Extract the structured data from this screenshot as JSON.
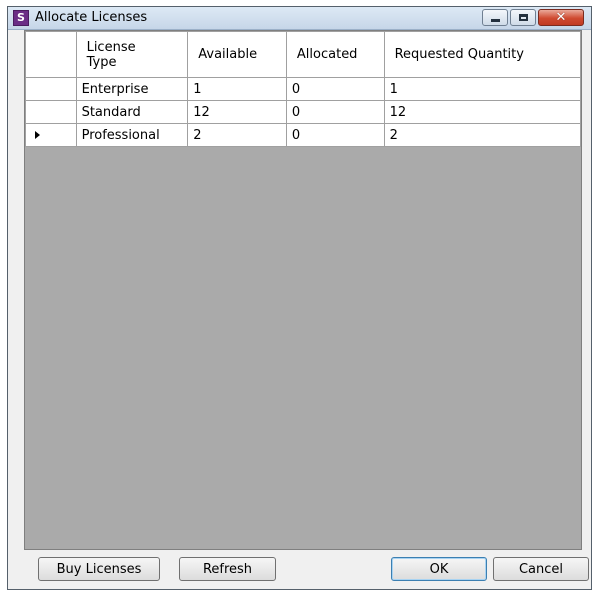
{
  "window": {
    "title": "Allocate Licenses",
    "app_icon_letter": "S"
  },
  "grid": {
    "columns": [
      {
        "label": "License\nType"
      },
      {
        "label": "Available"
      },
      {
        "label": "Allocated"
      },
      {
        "label": "Requested Quantity"
      }
    ],
    "rows": [
      {
        "license_type": "Enterprise",
        "available": "1",
        "allocated": "0",
        "requested": "1",
        "current": false
      },
      {
        "license_type": "Standard",
        "available": "12",
        "allocated": "0",
        "requested": "12",
        "current": false
      },
      {
        "license_type": "Professional",
        "available": "2",
        "allocated": "0",
        "requested": "2",
        "current": true
      }
    ]
  },
  "buttons": {
    "buy_licenses": "Buy Licenses",
    "refresh": "Refresh",
    "ok": "OK",
    "cancel": "Cancel"
  },
  "colors": {
    "grid_background": "#aaaaaa",
    "close_button": "#cf4a31",
    "app_icon": "#6b2d86"
  }
}
